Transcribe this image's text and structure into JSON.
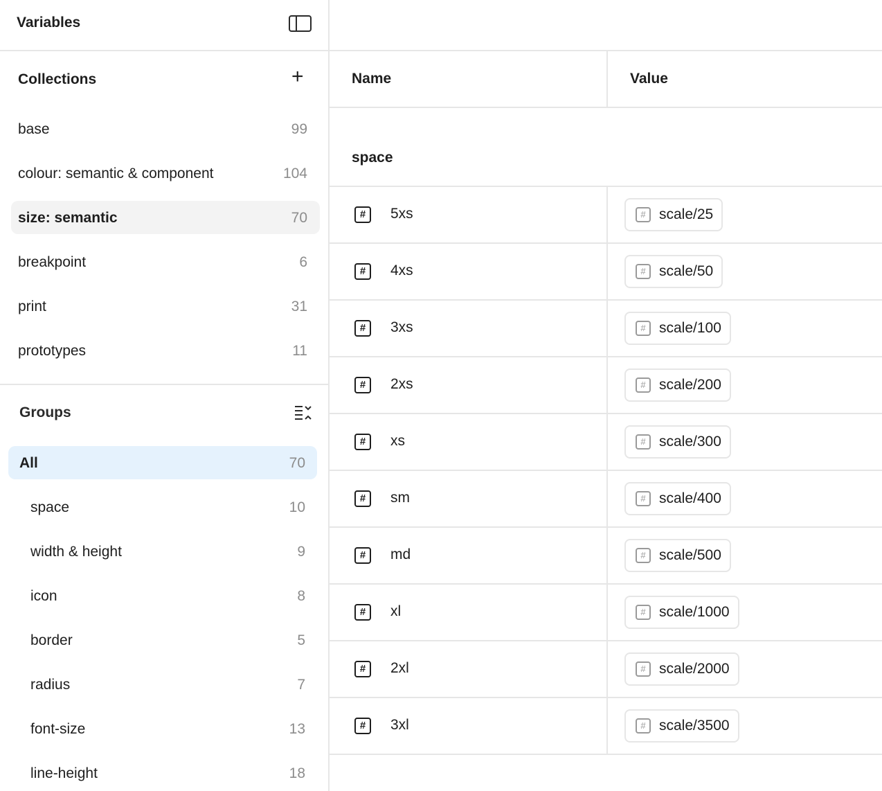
{
  "sidebar": {
    "title": "Variables",
    "collections_title": "Collections",
    "collections": [
      {
        "label": "base",
        "count": "99"
      },
      {
        "label": "colour: semantic & component",
        "count": "104"
      },
      {
        "label": "size: semantic",
        "count": "70"
      },
      {
        "label": "breakpoint",
        "count": "6"
      },
      {
        "label": "print",
        "count": "31"
      },
      {
        "label": "prototypes",
        "count": "11"
      }
    ],
    "selected_collection": "size: semantic",
    "groups_title": "Groups",
    "groups": [
      {
        "label": "All",
        "count": "70"
      },
      {
        "label": "space",
        "count": "10"
      },
      {
        "label": "width & height",
        "count": "9"
      },
      {
        "label": "icon",
        "count": "8"
      },
      {
        "label": "border",
        "count": "5"
      },
      {
        "label": "radius",
        "count": "7"
      },
      {
        "label": "font-size",
        "count": "13"
      },
      {
        "label": "line-height",
        "count": "18"
      }
    ],
    "selected_group": "All"
  },
  "table": {
    "name_header": "Name",
    "value_header": "Value",
    "group_label": "space",
    "rows": [
      {
        "name": "5xs",
        "value": "scale/25"
      },
      {
        "name": "4xs",
        "value": "scale/50"
      },
      {
        "name": "3xs",
        "value": "scale/100"
      },
      {
        "name": "2xs",
        "value": "scale/200"
      },
      {
        "name": "xs",
        "value": "scale/300"
      },
      {
        "name": "sm",
        "value": "scale/400"
      },
      {
        "name": "md",
        "value": "scale/500"
      },
      {
        "name": "xl",
        "value": "scale/1000"
      },
      {
        "name": "2xl",
        "value": "scale/2000"
      },
      {
        "name": "3xl",
        "value": "scale/3500"
      }
    ]
  },
  "icons": {
    "panel_toggle": "sidebar-toggle-icon",
    "add": "plus-icon",
    "collapse_groups": "collapse-list-icon",
    "number_variable": "number-variable-icon",
    "number_glyph": "#"
  },
  "colors": {
    "selected_collection_bg": "#f3f3f3",
    "selected_group_bg": "#e5f2fd",
    "border": "#e6e6e6",
    "muted_text": "#8c8c8c"
  }
}
